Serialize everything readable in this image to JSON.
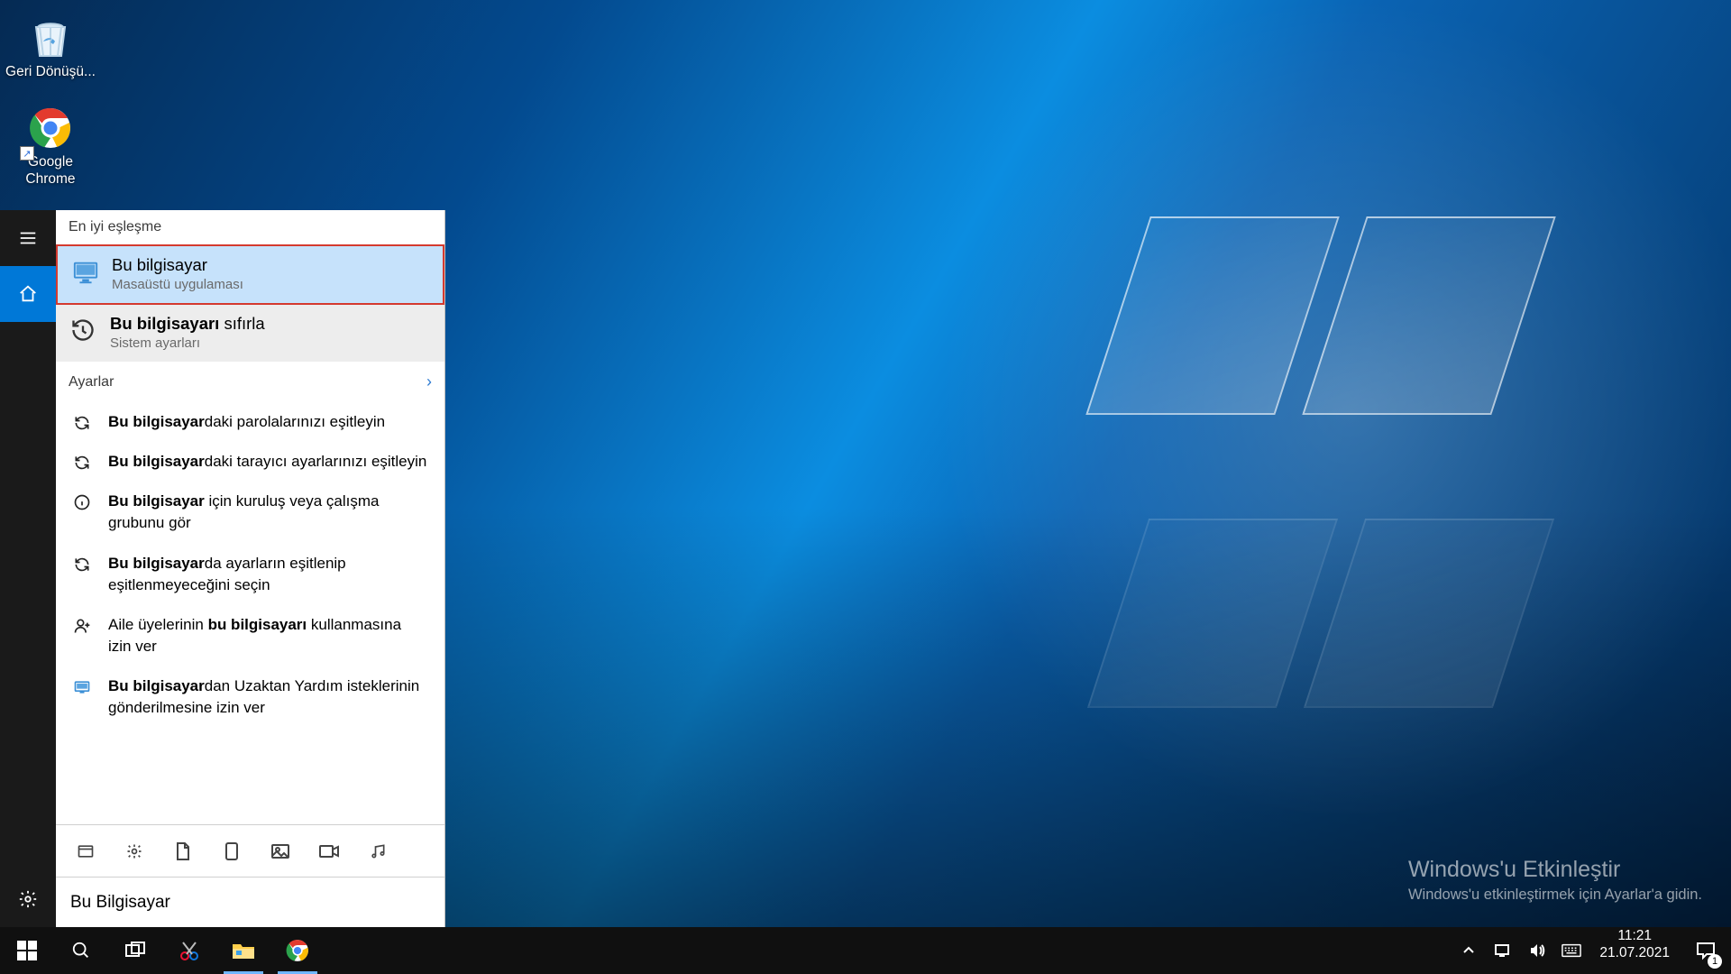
{
  "desktop_icons": {
    "recycle": "Geri Dönüşü...",
    "chrome": "Google Chrome"
  },
  "search": {
    "best_header": "En iyi eşleşme",
    "best_title": "Bu bilgisayar",
    "best_sub": "Masaüstü uygulaması",
    "second_title_bold": "Bu bilgisayarı",
    "second_title_rest": " sıfırla",
    "second_sub": "Sistem ayarları",
    "settings_header": "Ayarlar",
    "items": {
      "sync_passwords_bold": "Bu bilgisayar",
      "sync_passwords_rest": "daki parolalarınızı eşitleyin",
      "sync_browser_bold": "Bu bilgisayar",
      "sync_browser_rest": "daki tarayıcı ayarlarınızı eşitleyin",
      "workgroup_bold": "Bu bilgisayar",
      "workgroup_rest": " için kuruluş veya çalışma grubunu gör",
      "sync_settings_bold": "Bu bilgisayar",
      "sync_settings_rest": "da ayarların eşitlenip eşitlenmeyeceğini seçin",
      "family_pre": "Aile üyelerinin ",
      "family_bold": "bu bilgisayarı",
      "family_rest": " kullanmasına izin ver",
      "remote_bold": "Bu bilgisayar",
      "remote_rest": "dan Uzaktan Yardım isteklerinin gönderilmesine izin ver"
    },
    "input_value": "Bu Bilgisayar"
  },
  "watermark": {
    "line1": "Windows'u Etkinleştir",
    "line2": "Windows'u etkinleştirmek için Ayarlar'a gidin."
  },
  "taskbar": {
    "time": "11:21",
    "date": "21.07.2021",
    "notif_count": "1"
  }
}
